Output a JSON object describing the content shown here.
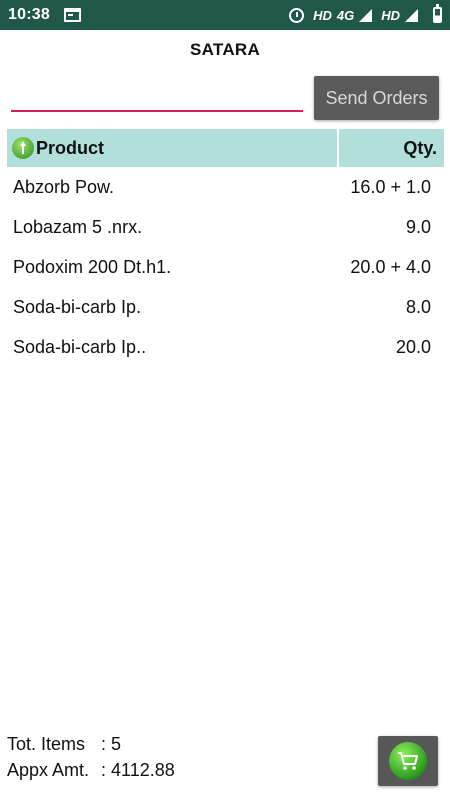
{
  "status_bar": {
    "time": "10:38",
    "hd1": "HD",
    "network": "4G",
    "hd2": "HD"
  },
  "header": {
    "title": "SATARA"
  },
  "order_input": {
    "value": "",
    "placeholder": ""
  },
  "send_button": {
    "label": "Send Orders"
  },
  "table": {
    "headers": {
      "product": "Product",
      "qty": "Qty."
    },
    "rows": [
      {
        "product": "Abzorb Pow.",
        "qty": "16.0 + 1.0"
      },
      {
        "product": "Lobazam 5 .nrx.",
        "qty": "9.0"
      },
      {
        "product": "Podoxim 200 Dt.h1.",
        "qty": "20.0 + 4.0"
      },
      {
        "product": "Soda-bi-carb Ip.",
        "qty": "8.0"
      },
      {
        "product": "Soda-bi-carb Ip..",
        "qty": "20.0"
      }
    ]
  },
  "footer": {
    "total_items_label": "Tot. Items",
    "total_items_value": ":  5",
    "amount_label": "Appx Amt.",
    "amount_value": ": 4112.88"
  },
  "colors": {
    "status_bar": "#1f5748",
    "header_row": "#b2dfdb",
    "input_underline": "#d81b60",
    "button": "#5a5a5a"
  },
  "icons": {
    "calendar": "calendar-icon",
    "alarm": "alarm-icon",
    "signal": "signal-icon",
    "battery": "battery-icon",
    "sort": "sort-arrow-icon",
    "cart": "cart-icon"
  }
}
